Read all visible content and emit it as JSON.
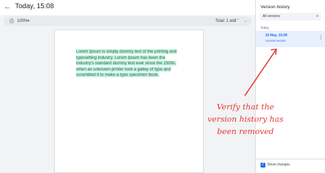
{
  "header": {
    "title": "Today, 15:08",
    "back_icon": "arrow-left-icon"
  },
  "toolbar": {
    "zoom": "100%",
    "edit_count": "Total: 1 edit",
    "print_icon": "printer-icon"
  },
  "document": {
    "text": "Lorem Ipsum is simply dummy text of the printing and typesetting industry. Lorem Ipsum has been the industry's standard dummy text ever since the 1500s, when an unknown printer took a galley of type and scrambled it to make a type specimen book."
  },
  "sidebar": {
    "title": "Version history",
    "filter": "All versions",
    "section": "Today",
    "item": {
      "date": "10 May, 15:08",
      "subtitle": "Current version"
    },
    "show_changes": "Show changes",
    "show_changes_checked": true
  },
  "annotation": {
    "lines": [
      "Verify that the",
      "version history has",
      "been removed"
    ],
    "color": "#e53935"
  }
}
